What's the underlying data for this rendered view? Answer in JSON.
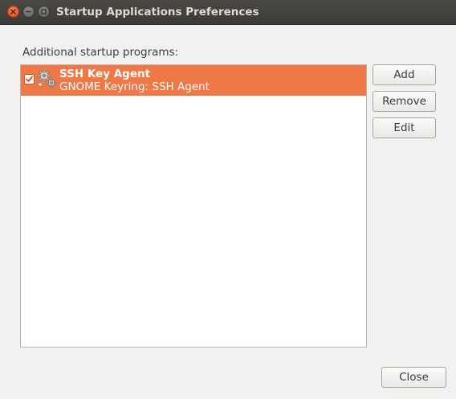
{
  "window": {
    "title": "Startup Applications Preferences"
  },
  "main": {
    "section_label": "Additional startup programs:",
    "programs": [
      {
        "name": "SSH Key Agent",
        "description": "GNOME Keyring: SSH Agent",
        "enabled": true,
        "selected": true,
        "icon": "gears-icon"
      }
    ]
  },
  "buttons": {
    "add": "Add",
    "remove": "Remove",
    "edit": "Edit",
    "close": "Close"
  },
  "colors": {
    "selection": "#f07746",
    "titlebar": "#3c3b37",
    "window_bg": "#f2f1f0",
    "close_button": "#df4c12"
  }
}
